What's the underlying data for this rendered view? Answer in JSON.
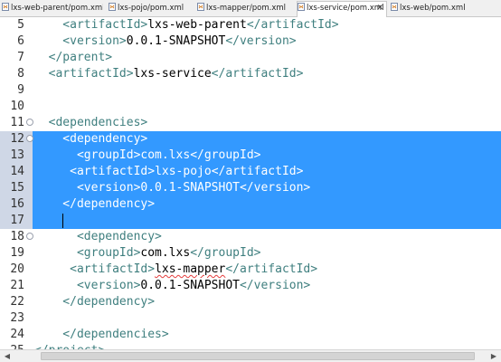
{
  "tabs": [
    {
      "label": "lxs-web-parent/pom.xml",
      "active": false
    },
    {
      "label": "lxs-pojo/pom.xml",
      "active": false
    },
    {
      "label": "lxs-mapper/pom.xml",
      "active": false
    },
    {
      "label": "lxs-service/pom.xml",
      "active": true
    },
    {
      "label": "lxs-web/pom.xml",
      "active": false
    }
  ],
  "tab_close_glyph": "✕",
  "editor": {
    "selection_color": "#3399ff",
    "tag_color": "#3f7f7f",
    "lines": [
      {
        "num": "5",
        "segments": [
          {
            "t": "t",
            "s": "    <artifactId>"
          },
          {
            "t": "v",
            "s": "lxs-web-parent"
          },
          {
            "t": "t",
            "s": "</artifactId>"
          }
        ]
      },
      {
        "num": "6",
        "segments": [
          {
            "t": "t",
            "s": "    <version>"
          },
          {
            "t": "v",
            "s": "0.0.1-SNAPSHOT"
          },
          {
            "t": "t",
            "s": "</version>"
          }
        ]
      },
      {
        "num": "7",
        "segments": [
          {
            "t": "t",
            "s": "  </parent>"
          }
        ]
      },
      {
        "num": "8",
        "segments": [
          {
            "t": "t",
            "s": "  <artifactId>"
          },
          {
            "t": "v",
            "s": "lxs-service"
          },
          {
            "t": "t",
            "s": "</artifactId>"
          }
        ]
      },
      {
        "num": "9",
        "segments": []
      },
      {
        "num": "10",
        "segments": []
      },
      {
        "num": "11",
        "fold": true,
        "segments": [
          {
            "t": "t",
            "s": "  <dependencies>"
          }
        ]
      },
      {
        "num": "12",
        "selected": true,
        "fold": true,
        "segments": [
          {
            "t": "t",
            "s": "    <dependency>"
          }
        ]
      },
      {
        "num": "13",
        "selected": true,
        "segments": [
          {
            "t": "t",
            "s": "      <groupId>"
          },
          {
            "t": "v",
            "s": "com.lxs"
          },
          {
            "t": "t",
            "s": "</groupId>"
          }
        ]
      },
      {
        "num": "14",
        "selected": true,
        "segments": [
          {
            "t": "t",
            "s": "     <artifactId>"
          },
          {
            "t": "v",
            "s": "lxs-pojo"
          },
          {
            "t": "t",
            "s": "</artifactId>"
          }
        ]
      },
      {
        "num": "15",
        "selected": true,
        "segments": [
          {
            "t": "t",
            "s": "      <version>"
          },
          {
            "t": "v",
            "s": "0.0.1-SNAPSHOT"
          },
          {
            "t": "t",
            "s": "</version>"
          }
        ]
      },
      {
        "num": "16",
        "selected": true,
        "segments": [
          {
            "t": "t",
            "s": "    </dependency>"
          }
        ]
      },
      {
        "num": "17",
        "selected": true,
        "caret": true,
        "segments": []
      },
      {
        "num": "18",
        "fold": true,
        "segments": [
          {
            "t": "t",
            "s": "      <dependency>"
          }
        ]
      },
      {
        "num": "19",
        "segments": [
          {
            "t": "t",
            "s": "      <groupId>"
          },
          {
            "t": "v",
            "s": "com.lxs"
          },
          {
            "t": "t",
            "s": "</groupId>"
          }
        ]
      },
      {
        "num": "20",
        "segments": [
          {
            "t": "t",
            "s": "     <artifactId>"
          },
          {
            "t": "v",
            "s": "lxs-mapper",
            "squiggle": true
          },
          {
            "t": "t",
            "s": "</artifactId>"
          }
        ]
      },
      {
        "num": "21",
        "segments": [
          {
            "t": "t",
            "s": "      <version>"
          },
          {
            "t": "v",
            "s": "0.0.1-SNAPSHOT"
          },
          {
            "t": "t",
            "s": "</version>"
          }
        ]
      },
      {
        "num": "22",
        "segments": [
          {
            "t": "t",
            "s": "    </dependency>"
          }
        ]
      },
      {
        "num": "23",
        "segments": []
      },
      {
        "num": "24",
        "segments": [
          {
            "t": "t",
            "s": "    </dependencies>"
          }
        ]
      },
      {
        "num": "25",
        "segments": [
          {
            "t": "t",
            "s": "</project>"
          }
        ]
      }
    ]
  },
  "scrollbar": {
    "left_arrow": "◀",
    "right_arrow": "▶"
  }
}
